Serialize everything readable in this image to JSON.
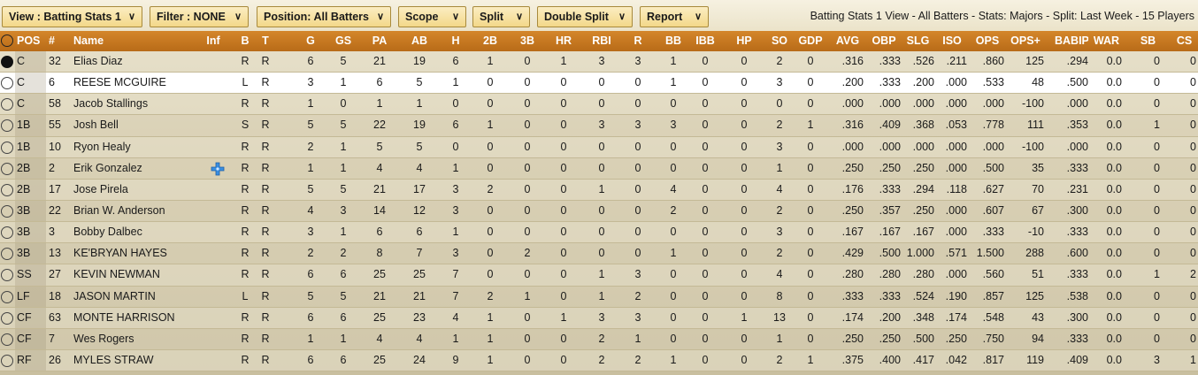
{
  "toolbar": {
    "view_label": "View : Batting Stats 1",
    "filter_label": "Filter : NONE",
    "position_label": "Position: All Batters",
    "scope_label": "Scope",
    "split_label": "Split",
    "double_split_label": "Double Split",
    "report_label": "Report",
    "status": "Batting Stats 1 View - All Batters - Stats: Majors - Split: Last Week - 15 Players"
  },
  "columns": [
    "POS",
    "#",
    "Name",
    "Inf",
    "B",
    "T",
    "G",
    "GS",
    "PA",
    "AB",
    "H",
    "2B",
    "3B",
    "HR",
    "RBI",
    "R",
    "BB",
    "IBB",
    "HP",
    "SO",
    "GDP",
    "AVG",
    "OBP",
    "SLG",
    "ISO",
    "OPS",
    "OPS+",
    "BABIP",
    "WAR",
    "SB",
    "CS"
  ],
  "rows": [
    {
      "selected": true,
      "injury": false,
      "cells": [
        "C",
        "32",
        "Elias Diaz",
        "",
        "R",
        "R",
        "6",
        "5",
        "21",
        "19",
        "6",
        "1",
        "0",
        "1",
        "3",
        "3",
        "1",
        "0",
        "0",
        "2",
        "0",
        ".316",
        ".333",
        ".526",
        ".211",
        ".860",
        "125",
        ".294",
        "0.0",
        "0",
        "0"
      ]
    },
    {
      "selected": false,
      "injury": false,
      "cells": [
        "C",
        "6",
        "REESE MCGUIRE",
        "",
        "L",
        "R",
        "3",
        "1",
        "6",
        "5",
        "1",
        "0",
        "0",
        "0",
        "0",
        "0",
        "1",
        "0",
        "0",
        "3",
        "0",
        ".200",
        ".333",
        ".200",
        ".000",
        ".533",
        "48",
        ".500",
        "0.0",
        "0",
        "0"
      ]
    },
    {
      "selected": false,
      "injury": false,
      "cells": [
        "C",
        "58",
        "Jacob Stallings",
        "",
        "R",
        "R",
        "1",
        "0",
        "1",
        "1",
        "0",
        "0",
        "0",
        "0",
        "0",
        "0",
        "0",
        "0",
        "0",
        "0",
        "0",
        ".000",
        ".000",
        ".000",
        ".000",
        ".000",
        "-100",
        ".000",
        "0.0",
        "0",
        "0"
      ]
    },
    {
      "selected": false,
      "injury": false,
      "cells": [
        "1B",
        "55",
        "Josh Bell",
        "",
        "S",
        "R",
        "5",
        "5",
        "22",
        "19",
        "6",
        "1",
        "0",
        "0",
        "3",
        "3",
        "3",
        "0",
        "0",
        "2",
        "1",
        ".316",
        ".409",
        ".368",
        ".053",
        ".778",
        "111",
        ".353",
        "0.0",
        "1",
        "0"
      ]
    },
    {
      "selected": false,
      "injury": false,
      "cells": [
        "1B",
        "10",
        "Ryon Healy",
        "",
        "R",
        "R",
        "2",
        "1",
        "5",
        "5",
        "0",
        "0",
        "0",
        "0",
        "0",
        "0",
        "0",
        "0",
        "0",
        "3",
        "0",
        ".000",
        ".000",
        ".000",
        ".000",
        ".000",
        "-100",
        ".000",
        "0.0",
        "0",
        "0"
      ]
    },
    {
      "selected": false,
      "injury": true,
      "cells": [
        "2B",
        "2",
        "Erik Gonzalez",
        "",
        "R",
        "R",
        "1",
        "1",
        "4",
        "4",
        "1",
        "0",
        "0",
        "0",
        "0",
        "0",
        "0",
        "0",
        "0",
        "1",
        "0",
        ".250",
        ".250",
        ".250",
        ".000",
        ".500",
        "35",
        ".333",
        "0.0",
        "0",
        "0"
      ]
    },
    {
      "selected": false,
      "injury": false,
      "cells": [
        "2B",
        "17",
        "Jose Pirela",
        "",
        "R",
        "R",
        "5",
        "5",
        "21",
        "17",
        "3",
        "2",
        "0",
        "0",
        "1",
        "0",
        "4",
        "0",
        "0",
        "4",
        "0",
        ".176",
        ".333",
        ".294",
        ".118",
        ".627",
        "70",
        ".231",
        "0.0",
        "0",
        "0"
      ]
    },
    {
      "selected": false,
      "injury": false,
      "cells": [
        "3B",
        "22",
        "Brian W. Anderson",
        "",
        "R",
        "R",
        "4",
        "3",
        "14",
        "12",
        "3",
        "0",
        "0",
        "0",
        "0",
        "0",
        "2",
        "0",
        "0",
        "2",
        "0",
        ".250",
        ".357",
        ".250",
        ".000",
        ".607",
        "67",
        ".300",
        "0.0",
        "0",
        "0"
      ]
    },
    {
      "selected": false,
      "injury": false,
      "cells": [
        "3B",
        "3",
        "Bobby Dalbec",
        "",
        "R",
        "R",
        "3",
        "1",
        "6",
        "6",
        "1",
        "0",
        "0",
        "0",
        "0",
        "0",
        "0",
        "0",
        "0",
        "3",
        "0",
        ".167",
        ".167",
        ".167",
        ".000",
        ".333",
        "-10",
        ".333",
        "0.0",
        "0",
        "0"
      ]
    },
    {
      "selected": false,
      "injury": false,
      "cells": [
        "3B",
        "13",
        "KE'BRYAN HAYES",
        "",
        "R",
        "R",
        "2",
        "2",
        "8",
        "7",
        "3",
        "0",
        "2",
        "0",
        "0",
        "0",
        "1",
        "0",
        "0",
        "2",
        "0",
        ".429",
        ".500",
        "1.000",
        ".571",
        "1.500",
        "288",
        ".600",
        "0.0",
        "0",
        "0"
      ]
    },
    {
      "selected": false,
      "injury": false,
      "cells": [
        "SS",
        "27",
        "KEVIN NEWMAN",
        "",
        "R",
        "R",
        "6",
        "6",
        "25",
        "25",
        "7",
        "0",
        "0",
        "0",
        "1",
        "3",
        "0",
        "0",
        "0",
        "4",
        "0",
        ".280",
        ".280",
        ".280",
        ".000",
        ".560",
        "51",
        ".333",
        "0.0",
        "1",
        "2"
      ]
    },
    {
      "selected": false,
      "injury": false,
      "cells": [
        "LF",
        "18",
        "JASON MARTIN",
        "",
        "L",
        "R",
        "5",
        "5",
        "21",
        "21",
        "7",
        "2",
        "1",
        "0",
        "1",
        "2",
        "0",
        "0",
        "0",
        "8",
        "0",
        ".333",
        ".333",
        ".524",
        ".190",
        ".857",
        "125",
        ".538",
        "0.0",
        "0",
        "0"
      ]
    },
    {
      "selected": false,
      "injury": false,
      "cells": [
        "CF",
        "63",
        "MONTE HARRISON",
        "",
        "R",
        "R",
        "6",
        "6",
        "25",
        "23",
        "4",
        "1",
        "0",
        "1",
        "3",
        "3",
        "0",
        "0",
        "1",
        "13",
        "0",
        ".174",
        ".200",
        ".348",
        ".174",
        ".548",
        "43",
        ".300",
        "0.0",
        "0",
        "0"
      ]
    },
    {
      "selected": false,
      "injury": false,
      "cells": [
        "CF",
        "7",
        "Wes Rogers",
        "",
        "R",
        "R",
        "1",
        "1",
        "4",
        "4",
        "1",
        "1",
        "0",
        "0",
        "2",
        "1",
        "0",
        "0",
        "0",
        "1",
        "0",
        ".250",
        ".250",
        ".500",
        ".250",
        ".750",
        "94",
        ".333",
        "0.0",
        "0",
        "0"
      ]
    },
    {
      "selected": false,
      "injury": false,
      "cells": [
        "RF",
        "26",
        "MYLES STRAW",
        "",
        "R",
        "R",
        "6",
        "6",
        "25",
        "24",
        "9",
        "1",
        "0",
        "0",
        "2",
        "2",
        "1",
        "0",
        "0",
        "2",
        "1",
        ".375",
        ".400",
        ".417",
        ".042",
        ".817",
        "119",
        ".409",
        "0.0",
        "3",
        "1"
      ]
    }
  ],
  "icons": {
    "select": "radio-icon",
    "injury": "medical-cross-icon",
    "dropdown": "chevron-down-icon"
  },
  "colors": {
    "header": "#c8771f",
    "dropdown": "#f3d889",
    "injury": "#3a8ee0"
  }
}
